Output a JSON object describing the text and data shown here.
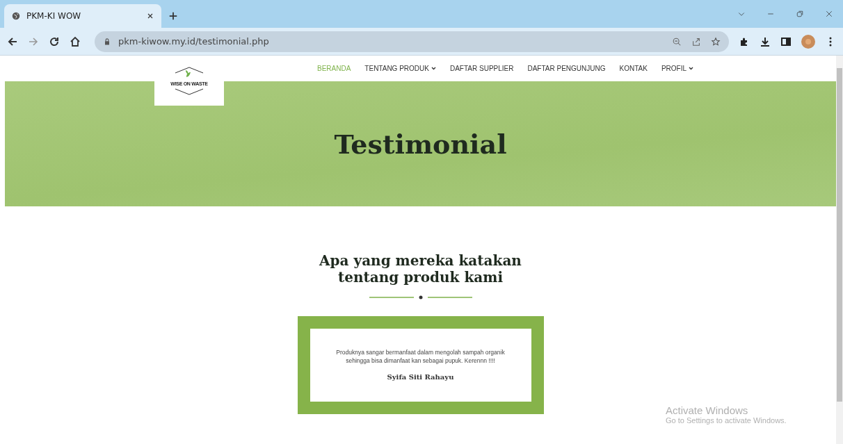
{
  "browser": {
    "tabs": [
      {
        "title": "PKM-KI WOW",
        "selected": true
      }
    ],
    "address": "pkm-kiwow.my.id/testimonial.php"
  },
  "logo": {
    "text": "WISE ON WASTE"
  },
  "nav": [
    {
      "label": "BERANDA",
      "selected": true,
      "dropdown": false
    },
    {
      "label": "TENTANG PRODUK",
      "selected": false,
      "dropdown": true
    },
    {
      "label": "DAFTAR SUPPLIER",
      "selected": false,
      "dropdown": false
    },
    {
      "label": "DAFTAR PENGUNJUNG",
      "selected": false,
      "dropdown": false
    },
    {
      "label": "KONTAK",
      "selected": false,
      "dropdown": false
    },
    {
      "label": "PROFIL",
      "selected": false,
      "dropdown": true
    }
  ],
  "hero": {
    "title": "Testimonial"
  },
  "section": {
    "heading": "Apa yang mereka katakan tentang produk kami"
  },
  "testimonials": [
    {
      "quote": "Produknya sangar bermanfaat dalam mengolah sampah organik sehingga bisa dimanfaat kan sebagai pupuk. Kerennn !!!!",
      "author": "Syifa Siti Rahayu"
    }
  ],
  "os_notice": {
    "title": "Activate Windows",
    "text": "Go to Settings to activate Windows."
  }
}
